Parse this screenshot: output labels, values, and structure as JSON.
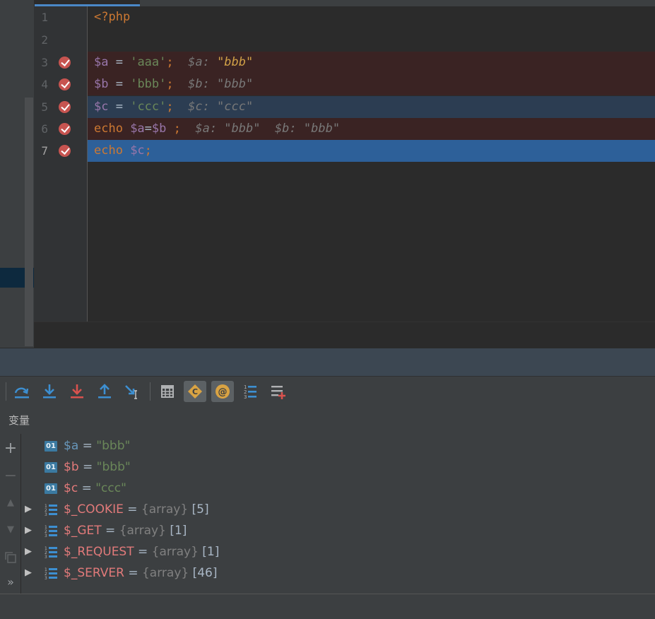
{
  "editor": {
    "lines": [
      {
        "num": "1",
        "bg": "plain",
        "breakpoint": false,
        "current": false,
        "tokens": [
          {
            "t": "<?php",
            "c": "kw"
          }
        ]
      },
      {
        "num": "2",
        "bg": "plain",
        "breakpoint": false,
        "current": false,
        "tokens": []
      },
      {
        "num": "3",
        "bg": "bp",
        "breakpoint": true,
        "current": false,
        "tokens": [
          {
            "t": "$a",
            "c": "var"
          },
          {
            "t": " = ",
            "c": "op"
          },
          {
            "t": "'aaa'",
            "c": "str"
          },
          {
            "t": ";",
            "c": "kw"
          },
          {
            "t": "  $a: ",
            "c": "hint"
          },
          {
            "t": "\"bbb\"",
            "c": "hint-val"
          }
        ]
      },
      {
        "num": "4",
        "bg": "bp",
        "breakpoint": true,
        "current": false,
        "tokens": [
          {
            "t": "$b",
            "c": "var"
          },
          {
            "t": " = ",
            "c": "op"
          },
          {
            "t": "'bbb'",
            "c": "str"
          },
          {
            "t": ";",
            "c": "kw"
          },
          {
            "t": "  $b: \"bbb\"",
            "c": "hint"
          }
        ]
      },
      {
        "num": "5",
        "bg": "sel",
        "breakpoint": true,
        "current": false,
        "tokens": [
          {
            "t": "$c",
            "c": "var"
          },
          {
            "t": " = ",
            "c": "op"
          },
          {
            "t": "'ccc'",
            "c": "str"
          },
          {
            "t": ";",
            "c": "kw"
          },
          {
            "t": "  $c: \"ccc\"",
            "c": "hint"
          }
        ]
      },
      {
        "num": "6",
        "bg": "bp",
        "breakpoint": true,
        "current": false,
        "tokens": [
          {
            "t": "echo ",
            "c": "kw"
          },
          {
            "t": "$a",
            "c": "var"
          },
          {
            "t": "=",
            "c": "op"
          },
          {
            "t": "$b",
            "c": "var"
          },
          {
            "t": " ;",
            "c": "kw"
          },
          {
            "t": "  $a: \"bbb\"  $b: \"bbb\"",
            "c": "hint"
          }
        ]
      },
      {
        "num": "7",
        "bg": "exec",
        "breakpoint": true,
        "current": true,
        "tokens": [
          {
            "t": "echo ",
            "c": "kw"
          },
          {
            "t": "$c",
            "c": "var"
          },
          {
            "t": ";",
            "c": "kw"
          }
        ]
      }
    ]
  },
  "toolbar": {
    "buttons": [
      {
        "name": "step-over-icon",
        "active": false
      },
      {
        "name": "step-into-icon",
        "active": false
      },
      {
        "name": "force-step-into-icon",
        "active": false
      },
      {
        "name": "step-out-icon",
        "active": false
      },
      {
        "name": "run-to-cursor-icon",
        "active": false
      },
      {
        "name": "evaluate-expression-icon",
        "active": false
      },
      {
        "name": "show-constants-icon",
        "active": true
      },
      {
        "name": "show-references-icon",
        "active": true
      },
      {
        "name": "frames-list-icon",
        "active": false
      },
      {
        "name": "add-watch-icon",
        "active": false
      }
    ]
  },
  "variables": {
    "title": "变量",
    "items": [
      {
        "kind": "primitive",
        "icon_label": "01",
        "name": "$a",
        "name_style": "a",
        "value": "\"bbb\"",
        "expandable": false
      },
      {
        "kind": "primitive",
        "icon_label": "01",
        "name": "$b",
        "name_style": "n",
        "value": "\"bbb\"",
        "expandable": false
      },
      {
        "kind": "primitive",
        "icon_label": "01",
        "name": "$c",
        "name_style": "n",
        "value": "\"ccc\"",
        "expandable": false
      },
      {
        "kind": "array",
        "name": "$_COOKIE",
        "name_style": "n",
        "type": "{array}",
        "count": "[5]",
        "expandable": true
      },
      {
        "kind": "array",
        "name": "$_GET",
        "name_style": "n",
        "type": "{array}",
        "count": "[1]",
        "expandable": true
      },
      {
        "kind": "array",
        "name": "$_REQUEST",
        "name_style": "n",
        "type": "{array}",
        "count": "[1]",
        "expandable": true
      },
      {
        "kind": "array",
        "name": "$_SERVER",
        "name_style": "n",
        "type": "{array}",
        "count": "[46]",
        "expandable": true
      }
    ]
  },
  "side_tools": {
    "add": "+",
    "remove": "−",
    "up": "▲",
    "down": "▼",
    "more": "»"
  },
  "colors": {
    "exec_line": "#2d6099",
    "breakpoint_line": "#3a2323",
    "breakpoint": "#c75450",
    "accent": "#4a88c7"
  }
}
